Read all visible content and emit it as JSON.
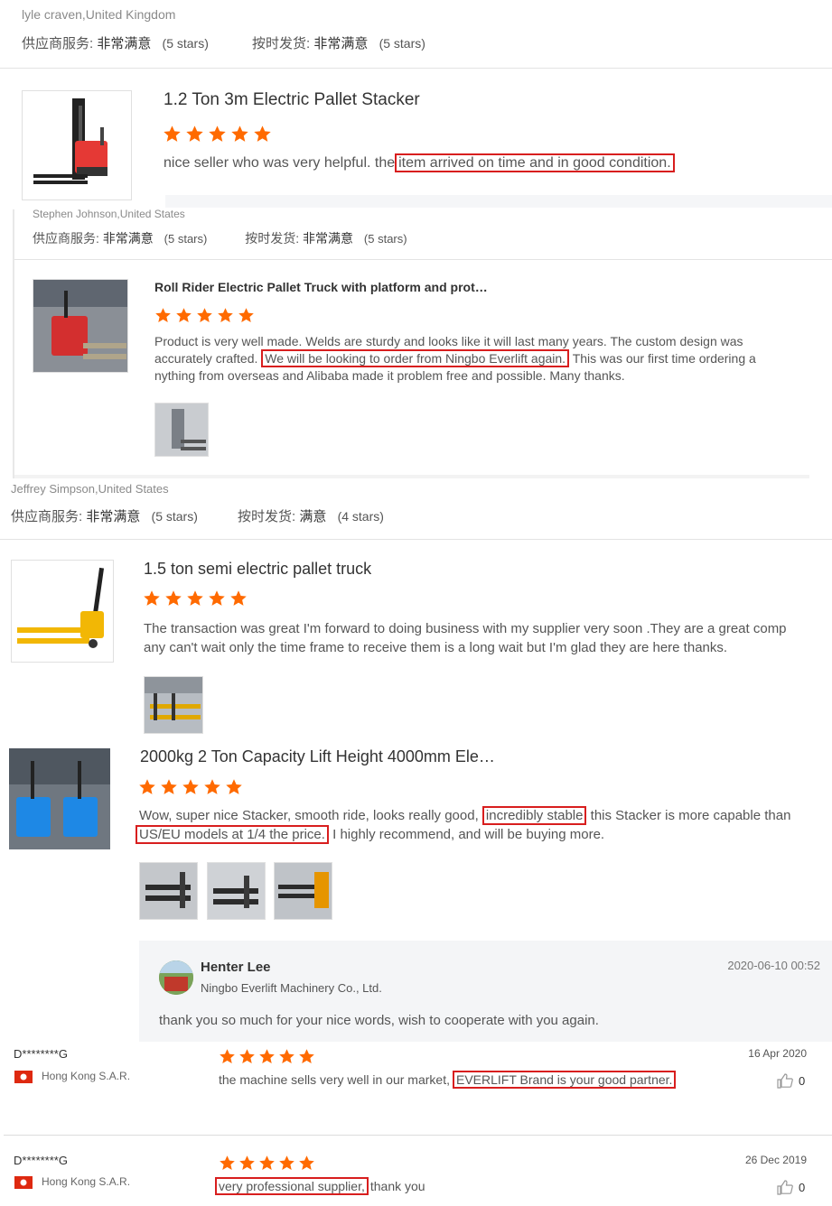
{
  "r1": {
    "reviewer": "lyle craven,United Kingdom",
    "supplier_label": "供应商服务:",
    "supplier_value": "非常满意",
    "supplier_stars": "(5 stars)",
    "delivery_label": "按时发货:",
    "delivery_value": "非常满意",
    "delivery_stars": "(5 stars)",
    "product_title": "1.2 Ton 3m Electric Pallet Stacker",
    "text_before": "nice seller who was very helpful. the",
    "text_highlight": "item arrived on time and in good condition."
  },
  "r2": {
    "reviewer": "Stephen Johnson,United States",
    "supplier_label": "供应商服务:",
    "supplier_value": "非常满意",
    "supplier_stars": "(5 stars)",
    "delivery_label": "按时发货:",
    "delivery_value": "非常满意",
    "delivery_stars": "(5 stars)",
    "product_title": "Roll Rider Electric Pallet Truck with platform and prot…",
    "text_before": "Product is very well made.  Welds are sturdy and looks like it will last many years.  The custom design was accurately crafted.",
    "text_highlight": "We will be looking to order from Ningbo Everlift again.",
    "text_after": "This was our first time ordering a nything from overseas and Alibaba made it problem free and possible. Many thanks."
  },
  "r3": {
    "reviewer": "Jeffrey Simpson,United States",
    "supplier_label": "供应商服务:",
    "supplier_value": "非常满意",
    "supplier_stars": "(5 stars)",
    "delivery_label": "按时发货:",
    "delivery_value": "满意",
    "delivery_stars": "(4 stars)",
    "product_title": "1.5 ton semi electric pallet truck",
    "text_line1": "The transaction was great I'm forward to doing business with my supplier very soon .They are a great comp",
    "text_line2": "any can't wait only the time frame to receive them is a long wait but I'm glad they are here thanks."
  },
  "r4": {
    "product_title": "2000kg 2 Ton Capacity Lift Height 4000mm Ele…",
    "text_a": "Wow, super nice Stacker, smooth ride, looks really good,",
    "text_hl1": "incredibly stable",
    "text_b": "this Stacker is more capable than",
    "text_hl2": "US/EU models at 1/4 the price.",
    "text_c": "I highly recommend, and will be buying more."
  },
  "reply": {
    "name": "Henter Lee",
    "company": "Ningbo Everlift Machinery Co., Ltd.",
    "date": "2020-06-10 00:52",
    "text": "thank you so much for your nice words, wish to cooperate with you again."
  },
  "r5": {
    "reviewer": "D********G",
    "region": "Hong Kong S.A.R.",
    "date": "16 Apr 2020",
    "text_before": "the machine sells very well in our market,",
    "text_highlight": "EVERLIFT Brand is your good partner.",
    "likes": "0"
  },
  "r6": {
    "reviewer": "D********G",
    "region": "Hong Kong S.A.R.",
    "date": "26 Dec 2019",
    "text_highlight": "very professional supplier,",
    "text_after": "thank you",
    "likes": "0"
  },
  "colors": {
    "star": "#ff6a00",
    "highlight": "#d81e1e",
    "flag": "#de2910"
  }
}
